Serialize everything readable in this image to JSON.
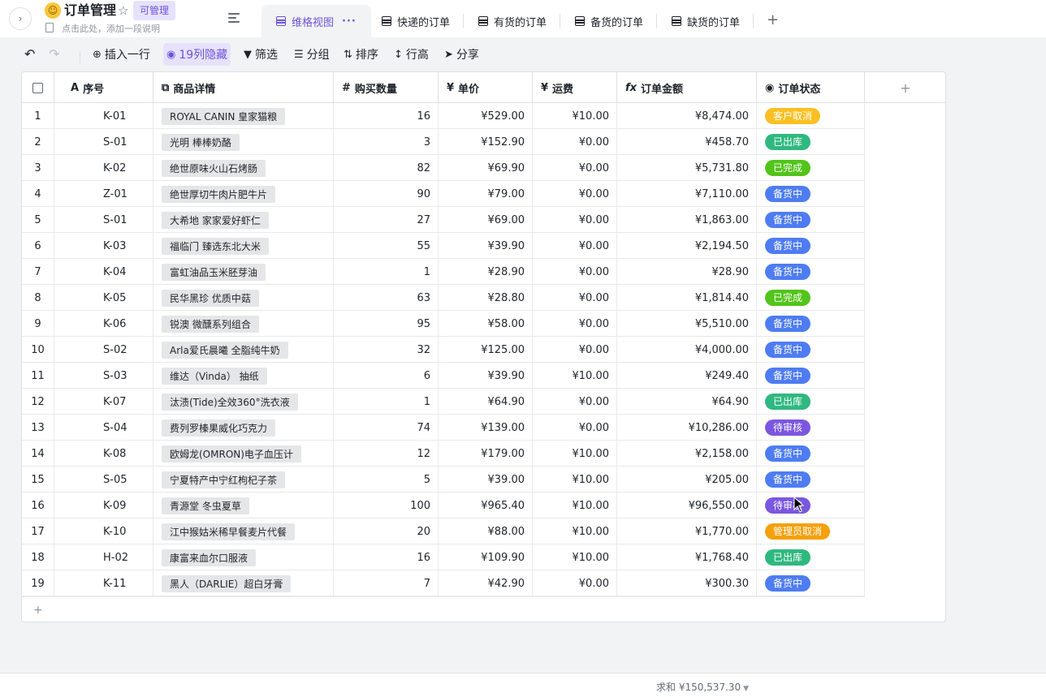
{
  "header": {
    "title": "订单管理",
    "permission_badge": "可管理",
    "description": "点击此处，添加一段说明"
  },
  "tabs": [
    {
      "label": "维格视图",
      "active": true
    },
    {
      "label": "快递的订单"
    },
    {
      "label": "有货的订单"
    },
    {
      "label": "备货的订单"
    },
    {
      "label": "缺货的订单"
    }
  ],
  "toolbar": {
    "insert_row": "插入一行",
    "hidden_cols": "19列隐藏",
    "filter": "筛选",
    "group": "分组",
    "sort": "排序",
    "row_height": "行高",
    "share": "分享"
  },
  "columns": {
    "seq": "序号",
    "product": "商品详情",
    "qty": "购买数量",
    "price": "单价",
    "shipping": "运费",
    "amount": "订单金额",
    "status": "订单状态"
  },
  "status_colors": {
    "客户取消": "#fac023",
    "已出库": "#2fb87f",
    "已完成": "#52c41a",
    "备货中": "#4e7cf2",
    "待审核": "#7b57e0",
    "管理员取消": "#f5a00c"
  },
  "rows": [
    {
      "num": "1",
      "id": "K-01",
      "product": "ROYAL CANIN 皇家猫粮",
      "qty": "16",
      "price": "¥529.00",
      "shipping": "¥10.00",
      "amount": "¥8,474.00",
      "status": "客户取消"
    },
    {
      "num": "2",
      "id": "S-01",
      "product": "光明 棒棒奶酪",
      "qty": "3",
      "price": "¥152.90",
      "shipping": "¥0.00",
      "amount": "¥458.70",
      "status": "已出库"
    },
    {
      "num": "3",
      "id": "K-02",
      "product": "绝世原味火山石烤肠",
      "qty": "82",
      "price": "¥69.90",
      "shipping": "¥0.00",
      "amount": "¥5,731.80",
      "status": "已完成"
    },
    {
      "num": "4",
      "id": "Z-01",
      "product": "绝世厚切牛肉片肥牛片",
      "qty": "90",
      "price": "¥79.00",
      "shipping": "¥0.00",
      "amount": "¥7,110.00",
      "status": "备货中"
    },
    {
      "num": "5",
      "id": "S-01",
      "product": "大希地 家家爱好虾仁",
      "qty": "27",
      "price": "¥69.00",
      "shipping": "¥0.00",
      "amount": "¥1,863.00",
      "status": "备货中"
    },
    {
      "num": "6",
      "id": "K-03",
      "product": "福临门 臻选东北大米",
      "qty": "55",
      "price": "¥39.90",
      "shipping": "¥0.00",
      "amount": "¥2,194.50",
      "status": "备货中"
    },
    {
      "num": "7",
      "id": "K-04",
      "product": "富虹油品玉米胚芽油",
      "qty": "1",
      "price": "¥28.90",
      "shipping": "¥0.00",
      "amount": "¥28.90",
      "status": "备货中"
    },
    {
      "num": "8",
      "id": "K-05",
      "product": "民华黑珍 优质中菇",
      "qty": "63",
      "price": "¥28.80",
      "shipping": "¥0.00",
      "amount": "¥1,814.40",
      "status": "已完成"
    },
    {
      "num": "9",
      "id": "K-06",
      "product": "锐澳 微醺系列组合",
      "qty": "95",
      "price": "¥58.00",
      "shipping": "¥0.00",
      "amount": "¥5,510.00",
      "status": "备货中"
    },
    {
      "num": "10",
      "id": "S-02",
      "product": "Arla爱氏晨曦 全脂纯牛奶",
      "qty": "32",
      "price": "¥125.00",
      "shipping": "¥0.00",
      "amount": "¥4,000.00",
      "status": "备货中"
    },
    {
      "num": "11",
      "id": "S-03",
      "product": "维达（Vinda） 抽纸",
      "qty": "6",
      "price": "¥39.90",
      "shipping": "¥10.00",
      "amount": "¥249.40",
      "status": "备货中"
    },
    {
      "num": "12",
      "id": "K-07",
      "product": "汰渍(Tide)全效360°洗衣液",
      "qty": "1",
      "price": "¥64.90",
      "shipping": "¥0.00",
      "amount": "¥64.90",
      "status": "已出库"
    },
    {
      "num": "13",
      "id": "S-04",
      "product": "费列罗榛果威化巧克力",
      "qty": "74",
      "price": "¥139.00",
      "shipping": "¥0.00",
      "amount": "¥10,286.00",
      "status": "待审核"
    },
    {
      "num": "14",
      "id": "K-08",
      "product": "欧姆龙(OMRON)电子血压计",
      "qty": "12",
      "price": "¥179.00",
      "shipping": "¥10.00",
      "amount": "¥2,158.00",
      "status": "备货中"
    },
    {
      "num": "15",
      "id": "S-05",
      "product": "宁夏特产中宁红枸杞子茶",
      "qty": "5",
      "price": "¥39.00",
      "shipping": "¥10.00",
      "amount": "¥205.00",
      "status": "备货中"
    },
    {
      "num": "16",
      "id": "K-09",
      "product": "青源堂 冬虫夏草",
      "qty": "100",
      "price": "¥965.40",
      "shipping": "¥10.00",
      "amount": "¥96,550.00",
      "status": "待审核"
    },
    {
      "num": "17",
      "id": "K-10",
      "product": "江中猴姑米稀早餐麦片代餐",
      "qty": "20",
      "price": "¥88.00",
      "shipping": "¥10.00",
      "amount": "¥1,770.00",
      "status": "管理员取消"
    },
    {
      "num": "18",
      "id": "H-02",
      "product": "康富来血尔口服液",
      "qty": "16",
      "price": "¥109.90",
      "shipping": "¥10.00",
      "amount": "¥1,768.40",
      "status": "已出库"
    },
    {
      "num": "19",
      "id": "K-11",
      "product": "黑人（DARLIE）超白牙膏",
      "qty": "7",
      "price": "¥42.90",
      "shipping": "¥0.00",
      "amount": "¥300.30",
      "status": "备货中"
    }
  ],
  "footer": {
    "sum": "求和 ¥150,537.30"
  }
}
